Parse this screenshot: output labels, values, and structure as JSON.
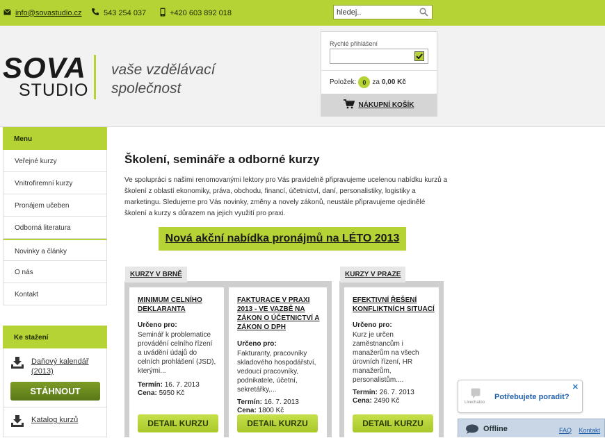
{
  "topbar": {
    "email": "info@sovastudio.cz",
    "phone1": "543 254 037",
    "phone2": "+420 603 892 018",
    "search_value": "hledej.."
  },
  "header": {
    "logo_main": "SOVA",
    "logo_sub": "STUDIO",
    "slogan_line1": "vaše vzdělávací",
    "slogan_line2": "společnost"
  },
  "login": {
    "label": "Rychlé přihlášení",
    "items_label": "Položek:",
    "items_count": "0",
    "total_prefix": "za",
    "total": "0,00 Kč",
    "cart_button": "NÁKUPNÍ KOŠÍK"
  },
  "sidebar": {
    "menu_title": "Menu",
    "items": [
      "Veřejné kurzy",
      "Vnitrofiremní kurzy",
      "Pronájem učeben",
      "Odborná literatura",
      "Novinky a články",
      "O nás",
      "Kontakt"
    ],
    "downloads_title": "Ke stažení",
    "download1": "Daňový kalendář (2013)",
    "download_button": "STÁHNOUT",
    "download2": "Katalog kurzů"
  },
  "main": {
    "title": "Školení, semináře a odborné kurzy",
    "intro": "Ve spolupráci s našimi renomovanými lektory pro Vás pravidelně připravujeme ucelenou nabídku kurzů a školení z oblastí ekonomiky, práva, obchodu, financí, účetnictví, daní, personalistiky, logistiky a marketingu. Sledujeme pro Vás novinky, změny a novely zákonů, neustále připravujeme ojedinělé školení a kurzy s důrazem na jejich využití pro praxi.",
    "promo": "Nová akční nabídka pronájmů na LÉTO 2013"
  },
  "sections": {
    "brno_tab": "KURZY V BRNĚ",
    "praha_tab": "KURZY V PRAZE"
  },
  "cards": [
    {
      "title": "MINIMUM CELNÍHO DEKLARANTA",
      "for_label": "Určeno pro:",
      "desc": "Seminář k problematice provádění celního řízení a uvádění údajů do celních prohlášení (JSD), kterými...",
      "term_label": "Termín:",
      "term": "16. 7. 2013",
      "price_label": "Cena:",
      "price": "5950 Kč",
      "button": "DETAIL KURZU"
    },
    {
      "title": "FAKTURACE V PRAXI 2013 - VE VAZBĚ NA ZÁKON O ÚČETNICTVÍ A ZÁKON O DPH",
      "for_label": "Určeno pro:",
      "desc": "Fakturanty, pracovníky skladového hospodářství, vedoucí pracovníky, podnikatele, účetní, sekretářky,...",
      "term_label": "Termín:",
      "term": "16. 7. 2013",
      "price_label": "Cena:",
      "price": "1800 Kč",
      "button": "DETAIL KURZU"
    },
    {
      "title": "EFEKTIVNÍ ŘEŠENÍ KONFLIKTNÍCH SITUACÍ",
      "for_label": "Určeno pro:",
      "desc": "Kurz je určen zaměstnancům i manažerům na všech úrovních řízení, HR manažerům, personalistům....",
      "term_label": "Termín:",
      "term": "26. 7. 2013",
      "price_label": "Cena:",
      "price": "2490 Kč",
      "button": "DETAIL KURZU"
    }
  ],
  "chat": {
    "question": "Potřebujete poradit?",
    "brand": "Livechatoo",
    "status": "Offline",
    "faq": "FAQ",
    "contact": "Kontakt"
  },
  "colors": {
    "accent": "#b5d334",
    "button_dark": "#6b8a1f",
    "chat_blue": "#1f5ea8"
  }
}
